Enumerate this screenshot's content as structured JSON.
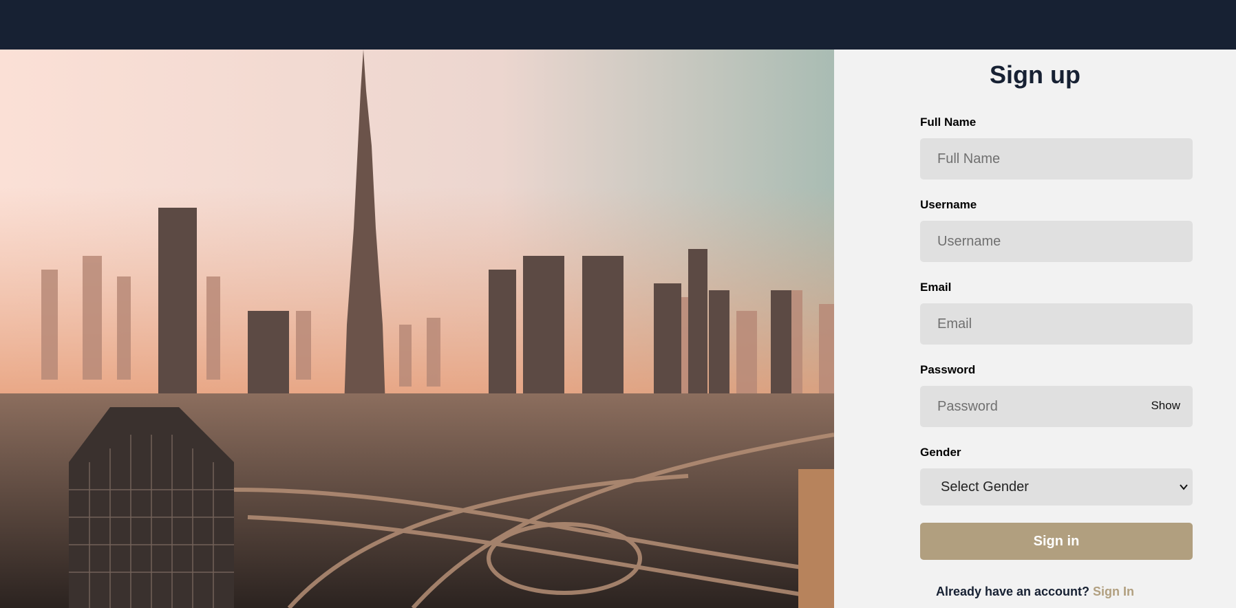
{
  "hero": {
    "image": "dubai-skyline-photo"
  },
  "form": {
    "title": "Sign up",
    "fields": {
      "full_name": {
        "label": "Full Name",
        "placeholder": "Full Name"
      },
      "username": {
        "label": "Username",
        "placeholder": "Username"
      },
      "email": {
        "label": "Email",
        "placeholder": "Email"
      },
      "password": {
        "label": "Password",
        "placeholder": "Password",
        "toggle_label": "Show"
      },
      "gender": {
        "label": "Gender",
        "selected": "Select Gender"
      }
    },
    "submit_label": "Sign in",
    "footer_text": "Already have an account?",
    "footer_link": "Sign In"
  },
  "colors": {
    "topbar": "#172133",
    "panel_bg": "#f2f2f2",
    "input_bg": "#e0e0e0",
    "accent": "#b19f7f",
    "title": "#172133"
  }
}
